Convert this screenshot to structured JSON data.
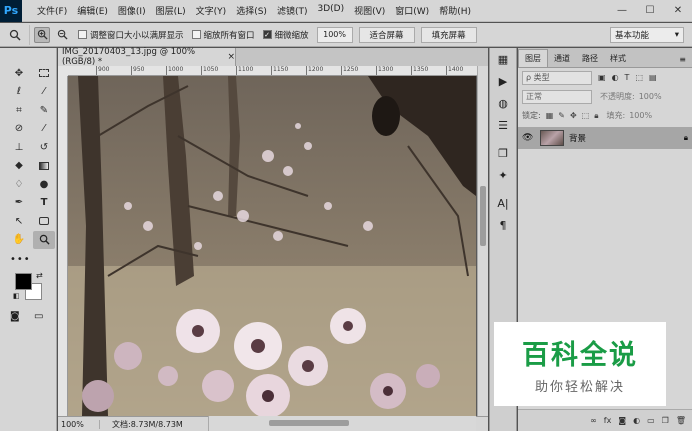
{
  "app": {
    "logo": "Ps"
  },
  "menu": {
    "items": [
      "文件(F)",
      "编辑(E)",
      "图像(I)",
      "图层(L)",
      "文字(Y)",
      "选择(S)",
      "滤镜(T)",
      "3D(D)",
      "视图(V)",
      "窗口(W)",
      "帮助(H)"
    ]
  },
  "window_controls": {
    "minimize": "—",
    "maximize": "☐",
    "close": "✕"
  },
  "options": {
    "tool_icon": "zoom-icon",
    "resize_windows": "调整窗口大小以满屏显示",
    "zoom_all": "缩放所有窗口",
    "scrubby": "细微缩放",
    "scrubby_checked": true,
    "zoom_value": "100%",
    "fit_screen": "适合屏幕",
    "fill_screen": "填充屏幕",
    "workspace": "基本功能"
  },
  "document": {
    "tab_title": "IMG_20170403_13.jpg @ 100%(RGB/8) *",
    "close": "×",
    "ruler_labels": [
      "900",
      "950",
      "1000",
      "1050",
      "1100",
      "1150",
      "1200",
      "1250",
      "1300",
      "1350",
      "1400"
    ],
    "status_zoom": "100%",
    "status_doc": "文档:8.73M/8.73M"
  },
  "panel": {
    "tabs": [
      "图层",
      "通道",
      "路径",
      "样式"
    ],
    "menu": "≡",
    "filter_kind": "ρ 类型",
    "blend_mode": "正常",
    "opacity_label": "不透明度:",
    "opacity_value": "100%",
    "lock_label": "锁定:",
    "fill_label": "填充:",
    "fill_value": "100%",
    "layer_name": "背景"
  },
  "watermark": {
    "title": "百科全说",
    "subtitle": "助你轻松解决"
  }
}
